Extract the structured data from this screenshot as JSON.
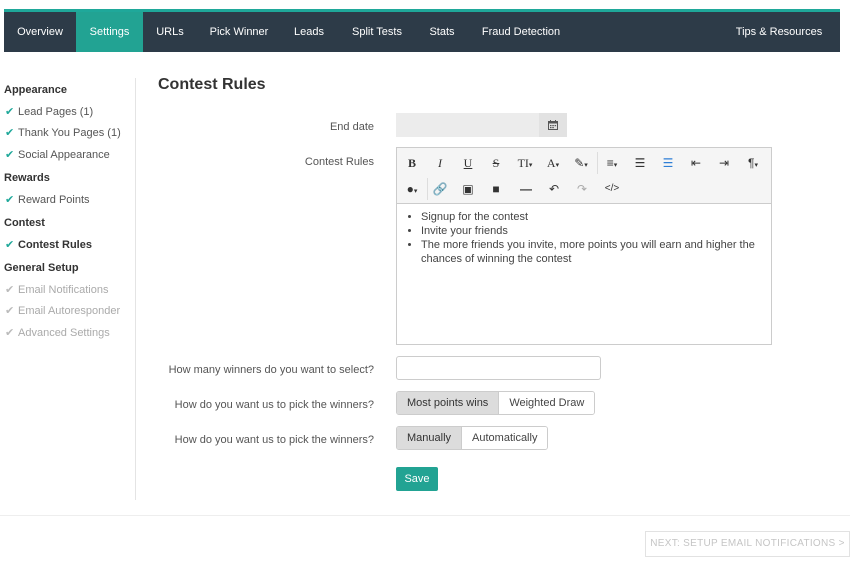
{
  "nav": {
    "tabs": [
      {
        "label": "Overview",
        "active": false
      },
      {
        "label": "Settings",
        "active": true
      },
      {
        "label": "URLs",
        "active": false
      },
      {
        "label": "Pick Winner",
        "active": false
      },
      {
        "label": "Leads",
        "active": false
      },
      {
        "label": "Split Tests",
        "active": false
      },
      {
        "label": "Stats",
        "active": false
      },
      {
        "label": "Fraud Detection",
        "active": false
      }
    ],
    "right_link": "Tips & Resources"
  },
  "sidebar": {
    "groups": [
      {
        "label": "Appearance",
        "items": [
          {
            "label": "Lead Pages (1)",
            "state": "done"
          },
          {
            "label": "Thank You Pages (1)",
            "state": "done"
          },
          {
            "label": "Social Appearance",
            "state": "done"
          }
        ]
      },
      {
        "label": "Rewards",
        "items": [
          {
            "label": "Reward Points",
            "state": "done"
          }
        ]
      },
      {
        "label": "Contest",
        "items": [
          {
            "label": "Contest Rules",
            "state": "active"
          }
        ]
      },
      {
        "label": "General Setup",
        "items": [
          {
            "label": "Email Notifications",
            "state": "disabled"
          },
          {
            "label": "Email Autoresponder",
            "state": "disabled"
          },
          {
            "label": "Advanced Settings",
            "state": "disabled"
          }
        ]
      }
    ]
  },
  "main": {
    "title": "Contest Rules",
    "end_date": {
      "label": "End date",
      "value": ""
    },
    "rules": {
      "label": "Contest Rules",
      "items": [
        "Signup for the contest",
        "Invite your friends",
        "The more friends you invite, more points you will earn and higher the chances of winning the contest"
      ]
    },
    "winners_count": {
      "label": "How many winners do you want to select?",
      "value": ""
    },
    "pick_method": {
      "label": "How do you want us to pick the winners?",
      "options": [
        "Most points wins",
        "Weighted Draw"
      ],
      "selected": "Most points wins"
    },
    "pick_mode": {
      "label": "How do you want us to pick the winners?",
      "options": [
        "Manually",
        "Automatically"
      ],
      "selected": "Manually"
    },
    "save_label": "Save"
  },
  "footer": {
    "next_label": "NEXT: SETUP EMAIL NOTIFICATIONS >"
  },
  "colors": {
    "accent": "#22a393",
    "nav_bg": "#2d3b48"
  }
}
